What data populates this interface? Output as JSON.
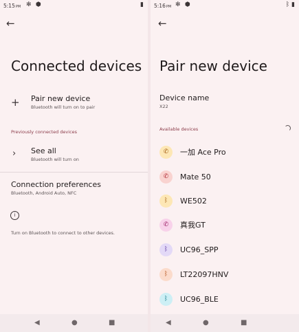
{
  "left": {
    "status_time": "5:15",
    "status_ampm": "PM",
    "title": "Connected devices",
    "pair_new": {
      "title": "Pair new device",
      "subtitle": "Bluetooth will turn on to pair"
    },
    "previous_label": "Previously connected devices",
    "see_all": {
      "title": "See all",
      "subtitle": "Bluetooth will turn on"
    },
    "conn_prefs": {
      "title": "Connection preferences",
      "subtitle": "Bluetooth, Android Auto, NFC"
    },
    "info_text": "Turn on Bluetooth to connect to other devices."
  },
  "right": {
    "status_time": "5:16",
    "status_ampm": "PM",
    "title": "Pair new device",
    "device_name_label": "Device name",
    "device_name_value": "X22",
    "available_label": "Available devices",
    "devices": [
      {
        "name": "一加 Ace Pro",
        "icon": "phone-icon",
        "color": "#fde7b5",
        "fg": "#a7641b"
      },
      {
        "name": "Mate 50",
        "icon": "phone-icon",
        "color": "#f9d3d0",
        "fg": "#b3313a"
      },
      {
        "name": "WE502",
        "icon": "bluetooth-icon",
        "color": "#fde7b5",
        "fg": "#a7641b"
      },
      {
        "name": "真我GT",
        "icon": "phone-icon",
        "color": "#f8d2ea",
        "fg": "#a0266c"
      },
      {
        "name": "UC96_SPP",
        "icon": "bluetooth-icon",
        "color": "#e3d9f7",
        "fg": "#5e3aa1"
      },
      {
        "name": "LT22097HNV",
        "icon": "bluetooth-icon",
        "color": "#fbdbcb",
        "fg": "#b5541d"
      },
      {
        "name": "UC96_BLE",
        "icon": "bluetooth-icon",
        "color": "#cdeff5",
        "fg": "#1b7f8e"
      }
    ]
  },
  "nav": {
    "back_icon": "◀",
    "home_icon": "●",
    "recents_icon": "■"
  }
}
